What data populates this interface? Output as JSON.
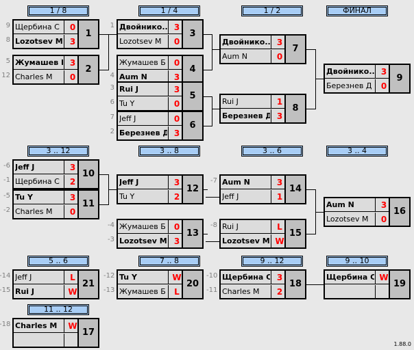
{
  "rounds": [
    {
      "label": "1 / 8"
    },
    {
      "label": "1 / 4"
    },
    {
      "label": "1 / 2"
    },
    {
      "label": "ФИНАЛ"
    },
    {
      "label": "3 .. 12"
    },
    {
      "label": "3 .. 8"
    },
    {
      "label": "3 .. 6"
    },
    {
      "label": "3 .. 4"
    },
    {
      "label": "5 .. 6"
    },
    {
      "label": "7 .. 8"
    },
    {
      "label": "9 .. 12"
    },
    {
      "label": "9 .. 10"
    },
    {
      "label": "11 .. 12"
    }
  ],
  "matches": [
    {
      "num": "1",
      "p": [
        {
          "seed": "9",
          "name": "Щербина С",
          "score": "0",
          "win": false
        },
        {
          "seed": "8",
          "name": "Lozotsev M",
          "score": "3",
          "win": true
        }
      ]
    },
    {
      "num": "2",
      "p": [
        {
          "seed": "5",
          "name": "Жумашев Б",
          "score": "3",
          "win": true
        },
        {
          "seed": "12",
          "name": "Charles M",
          "score": "0",
          "win": false
        }
      ]
    },
    {
      "num": "3",
      "p": [
        {
          "seed": "1",
          "name": "Двойнико...",
          "score": "3",
          "win": true
        },
        {
          "seed": "",
          "name": "Lozotsev M",
          "score": "0",
          "win": false
        }
      ]
    },
    {
      "num": "4",
      "p": [
        {
          "seed": "",
          "name": "Жумашев Б",
          "score": "0",
          "win": false
        },
        {
          "seed": "4",
          "name": "Aum N",
          "score": "3",
          "win": true
        }
      ]
    },
    {
      "num": "5",
      "p": [
        {
          "seed": "3",
          "name": "Rui J",
          "score": "3",
          "win": true
        },
        {
          "seed": "6",
          "name": "Tu Y",
          "score": "0",
          "win": false
        }
      ]
    },
    {
      "num": "6",
      "p": [
        {
          "seed": "7",
          "name": "Jeff J",
          "score": "0",
          "win": false
        },
        {
          "seed": "2",
          "name": "Березнев Д",
          "score": "3",
          "win": true
        }
      ]
    },
    {
      "num": "7",
      "p": [
        {
          "seed": "",
          "name": "Двойнико...",
          "score": "3",
          "win": true
        },
        {
          "seed": "",
          "name": "Aum N",
          "score": "0",
          "win": false
        }
      ]
    },
    {
      "num": "8",
      "p": [
        {
          "seed": "",
          "name": "Rui J",
          "score": "1",
          "win": false
        },
        {
          "seed": "",
          "name": "Березнев Д",
          "score": "3",
          "win": true
        }
      ]
    },
    {
      "num": "9",
      "p": [
        {
          "seed": "",
          "name": "Двойнико...",
          "score": "3",
          "win": true
        },
        {
          "seed": "",
          "name": "Березнев Д",
          "score": "0",
          "win": false
        }
      ]
    },
    {
      "num": "10",
      "p": [
        {
          "seed": "-6",
          "name": "Jeff J",
          "score": "3",
          "win": true
        },
        {
          "seed": "-1",
          "name": "Щербина С",
          "score": "2",
          "win": false
        }
      ]
    },
    {
      "num": "11",
      "p": [
        {
          "seed": "-5",
          "name": "Tu Y",
          "score": "3",
          "win": true
        },
        {
          "seed": "-2",
          "name": "Charles M",
          "score": "0",
          "win": false
        }
      ]
    },
    {
      "num": "12",
      "p": [
        {
          "seed": "",
          "name": "Jeff J",
          "score": "3",
          "win": true
        },
        {
          "seed": "",
          "name": "Tu Y",
          "score": "2",
          "win": false
        }
      ]
    },
    {
      "num": "13",
      "p": [
        {
          "seed": "-4",
          "name": "Жумашев Б",
          "score": "0",
          "win": false
        },
        {
          "seed": "-3",
          "name": "Lozotsev M",
          "score": "3",
          "win": true
        }
      ]
    },
    {
      "num": "14",
      "p": [
        {
          "seed": "-7",
          "name": "Aum N",
          "score": "3",
          "win": true
        },
        {
          "seed": "",
          "name": "Jeff J",
          "score": "1",
          "win": false
        }
      ]
    },
    {
      "num": "15",
      "p": [
        {
          "seed": "-8",
          "name": "Rui J",
          "score": "L",
          "win": false
        },
        {
          "seed": "",
          "name": "Lozotsev M",
          "score": "W",
          "win": true
        }
      ]
    },
    {
      "num": "16",
      "p": [
        {
          "seed": "",
          "name": "Aum N",
          "score": "3",
          "win": true
        },
        {
          "seed": "",
          "name": "Lozotsev M",
          "score": "0",
          "win": false
        }
      ]
    },
    {
      "num": "21",
      "p": [
        {
          "seed": "-14",
          "name": "Jeff J",
          "score": "L",
          "win": false
        },
        {
          "seed": "-15",
          "name": "Rui J",
          "score": "W",
          "win": true
        }
      ]
    },
    {
      "num": "20",
      "p": [
        {
          "seed": "-12",
          "name": "Tu Y",
          "score": "W",
          "win": true
        },
        {
          "seed": "-13",
          "name": "Жумашев Б",
          "score": "L",
          "win": false
        }
      ]
    },
    {
      "num": "18",
      "p": [
        {
          "seed": "-10",
          "name": "Щербина С",
          "score": "3",
          "win": true
        },
        {
          "seed": "-11",
          "name": "Charles M",
          "score": "2",
          "win": false
        }
      ]
    },
    {
      "num": "19",
      "p": [
        {
          "seed": "",
          "name": "Щербина С",
          "score": "W",
          "win": true
        },
        {
          "seed": "",
          "name": "",
          "score": "",
          "win": false
        }
      ]
    },
    {
      "num": "17",
      "p": [
        {
          "seed": "-18",
          "name": "Charles M",
          "score": "W",
          "win": true
        },
        {
          "seed": "",
          "name": "",
          "score": "",
          "win": false
        }
      ]
    }
  ],
  "version": "1.88.0"
}
